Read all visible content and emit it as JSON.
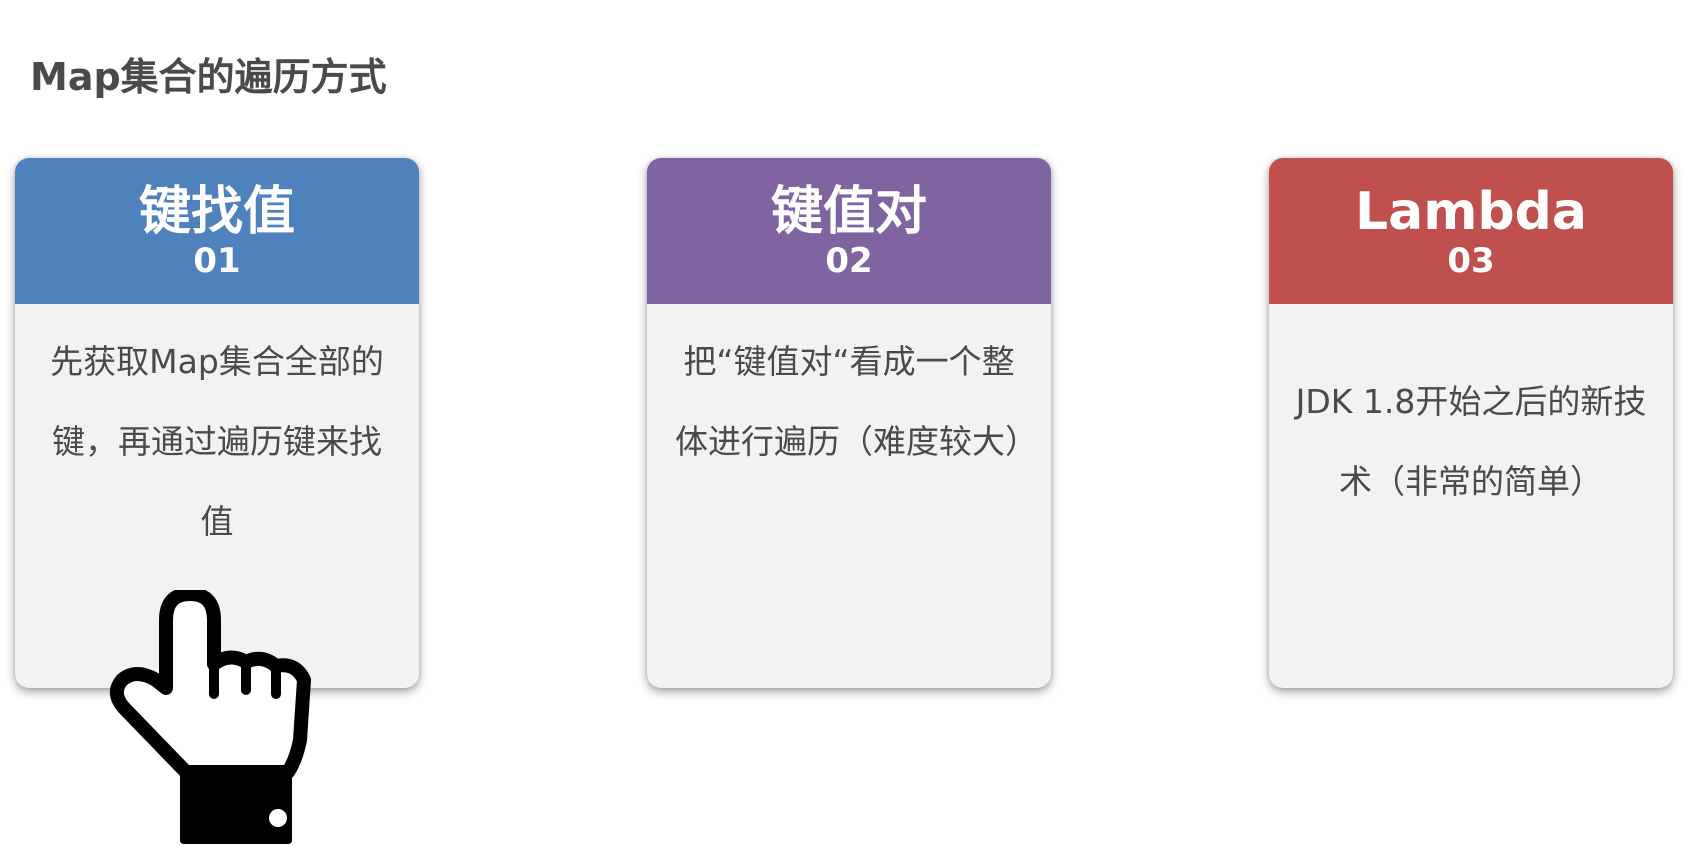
{
  "page": {
    "title": "Map集合的遍历方式"
  },
  "cards": [
    {
      "title": "键找值",
      "number": "01",
      "color": "#4f81bd",
      "description": "先获取Map集合全部的键，再通过遍历键来找值"
    },
    {
      "title": "键值对",
      "number": "02",
      "color": "#8064a2",
      "description": "把“键值对“看成一个整体进行遍历（难度较大）"
    },
    {
      "title": "Lambda",
      "number": "03",
      "color": "#c0504d",
      "description": "JDK 1.8开始之后的新技术（非常的简单）"
    }
  ],
  "pointer": {
    "icon": "pointing-hand-icon"
  }
}
